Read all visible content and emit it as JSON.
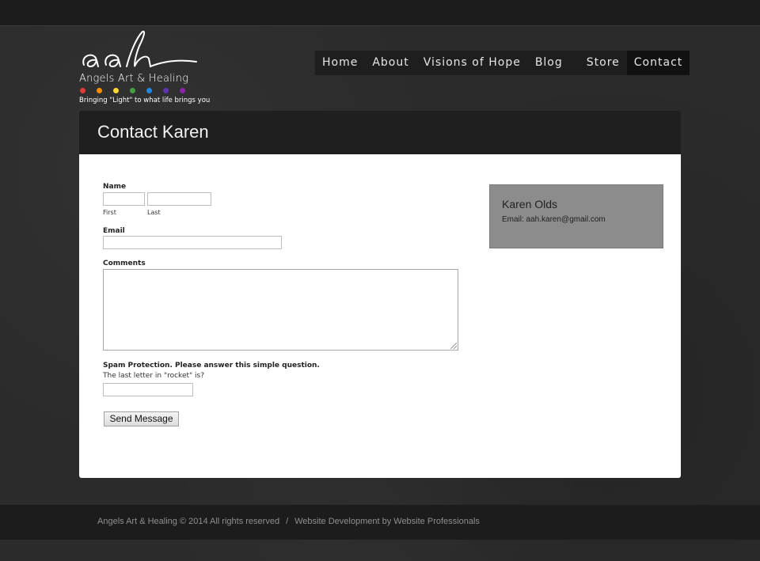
{
  "logo": {
    "script_text": "aah",
    "name": "Angels Art & Healing",
    "tagline": "Bringing \"Light\" to what life brings you",
    "dot_colors": [
      "#e53935",
      "#fb8c00",
      "#fdd835",
      "#43a047",
      "#1e88e5",
      "#5e35b1",
      "#8e24aa"
    ]
  },
  "nav": {
    "items": [
      {
        "label": "Home",
        "active": false
      },
      {
        "label": "About",
        "active": false
      },
      {
        "label": "Visions of Hope",
        "active": false
      },
      {
        "label": "Blog",
        "active": false
      },
      {
        "label": "Store",
        "active": false
      },
      {
        "label": "Contact",
        "active": true
      }
    ]
  },
  "page": {
    "title": "Contact Karen"
  },
  "form": {
    "name_label": "Name",
    "first_label": "First",
    "last_label": "Last",
    "first_value": "",
    "last_value": "",
    "email_label": "Email",
    "email_value": "",
    "comments_label": "Comments",
    "comments_value": "",
    "spam_label": "Spam Protection. Please answer this simple question.",
    "spam_question": "The last letter in \"rocket\" is?",
    "spam_value": "",
    "submit_label": "Send Message"
  },
  "contact_info": {
    "name": "Karen Olds",
    "email": "Email: aah.karen@gmail.com"
  },
  "footer": {
    "copyright": "Angels Art & Healing © 2014 All rights reserved",
    "separator": "/",
    "credit": "Website Development by Website Professionals"
  },
  "colors": {
    "background": "#2b2b2b",
    "content_bg": "#ffffff",
    "info_box": "#8c8c8c",
    "nav_bg": "#1e1e1e"
  }
}
